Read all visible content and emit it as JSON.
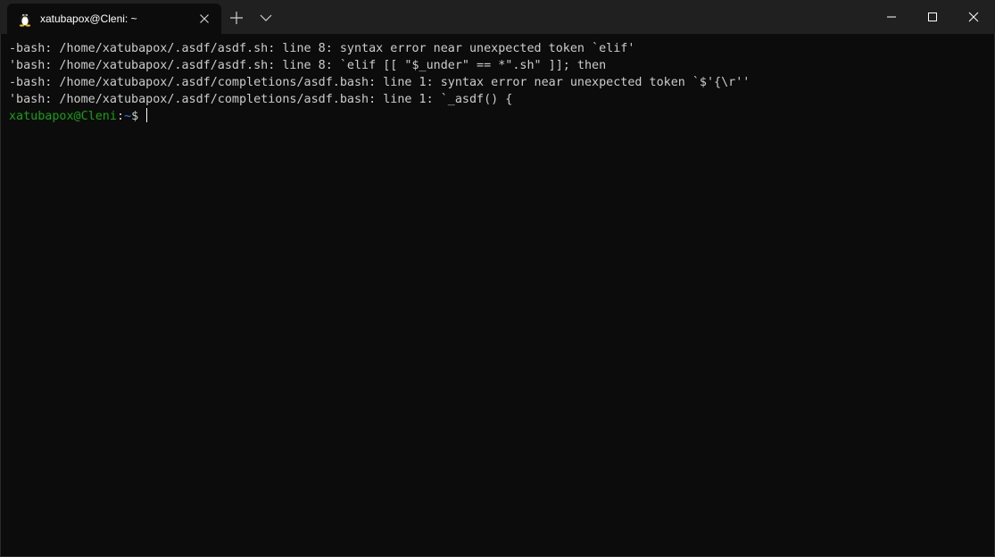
{
  "tab": {
    "title": "xatubapox@Cleni: ~",
    "icon": "linux-penguin-icon"
  },
  "window": {
    "min_icon": "minimize-icon",
    "max_icon": "maximize-icon",
    "close_icon": "close-icon"
  },
  "terminal": {
    "lines": [
      "-bash: /home/xatubapox/.asdf/asdf.sh: line 8: syntax error near unexpected token `elif'",
      "'bash: /home/xatubapox/.asdf/asdf.sh: line 8: `elif [[ \"$_under\" == *\".sh\" ]]; then",
      "-bash: /home/xatubapox/.asdf/completions/asdf.bash: line 1: syntax error near unexpected token `$'{\\r''",
      "'bash: /home/xatubapox/.asdf/completions/asdf.bash: line 1: `_asdf() {"
    ],
    "prompt": {
      "user_host": "xatubapox@Cleni",
      "separator": ":",
      "path": "~",
      "symbol": "$ "
    }
  },
  "colors": {
    "background": "#0c0c0c",
    "titlebar": "#202020",
    "foreground": "#cccccc",
    "prompt_user": "#13a10e",
    "prompt_path": "#3b78ff"
  }
}
